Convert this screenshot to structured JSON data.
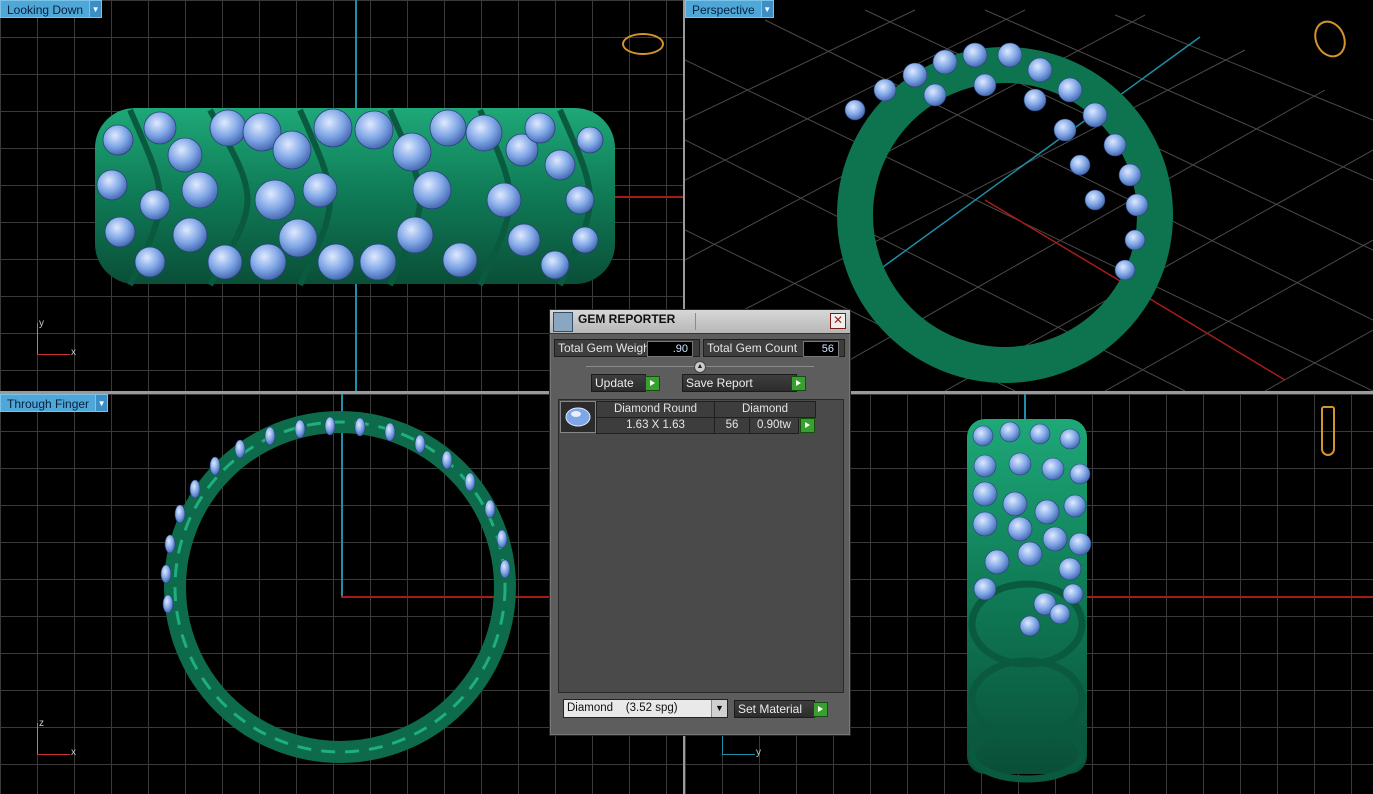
{
  "viewports": {
    "top_left": {
      "label": "Looking Down",
      "axis_a": "y",
      "axis_b": "x"
    },
    "top_right": {
      "label": "Perspective"
    },
    "bottom_left": {
      "label": "Through Finger",
      "axis_a": "z",
      "axis_b": "x"
    },
    "bottom_right": {
      "axis_b": "y"
    }
  },
  "colors": {
    "viewport_tab": "#4fa7d8",
    "metal": "#0f7a55",
    "gem": "#7fa6e6",
    "axis_red": "#a51c18",
    "axis_cyan": "#1f8ea8"
  },
  "dialog": {
    "title": "GEM REPORTER",
    "close_icon": "close-icon",
    "total_weight_label": "Total Gem Weight",
    "total_weight_value": ".90",
    "total_count_label": "Total Gem Count",
    "total_count_value": "56",
    "update_label": "Update",
    "save_report_label": "Save Report",
    "gem_row": {
      "shape": "Diamond Round",
      "material": "Diamond",
      "size": "1.63 X 1.63",
      "count": "56",
      "weight": "0.90tw"
    },
    "material_select": "Diamond    (3.52 spg)",
    "set_material_label": "Set Material"
  }
}
